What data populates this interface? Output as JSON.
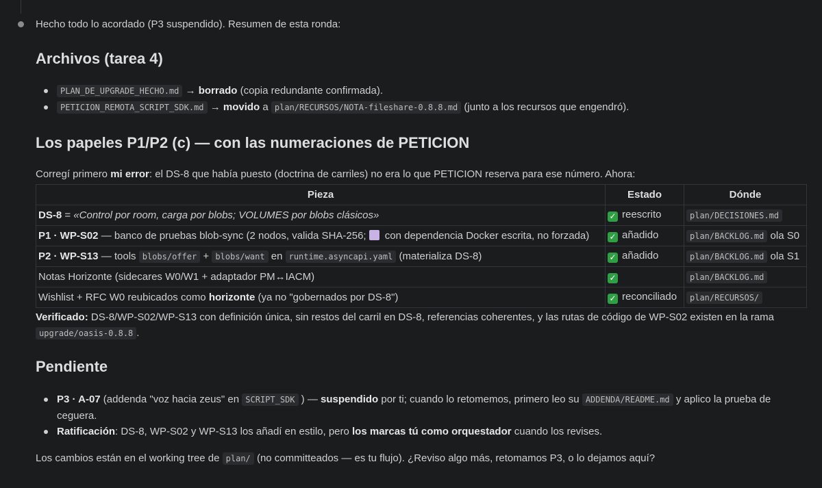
{
  "intro": "Hecho todo lo acordado (P3 suspendido). Resumen de esta ronda:",
  "section1": {
    "heading": "Archivos (tarea 4)",
    "items": [
      {
        "file": "PLAN_DE_UPGRADE_HECHO.md",
        "arrow": "→",
        "action": "borrado",
        "rest": "(copia redundante confirmada)."
      },
      {
        "file": "PETICION_REMOTA_SCRIPT_SDK.md",
        "arrow": "→",
        "action": "movido",
        "mid": "a",
        "path": "plan/RECURSOS/NOTA-fileshare-0.8.8.md",
        "rest": "(junto a los recursos que engendró)."
      }
    ]
  },
  "section2": {
    "heading": "Los papeles P1/P2 (c) — con las numeraciones de PETICION",
    "intro_pre": "Corregí primero",
    "intro_bold": "mi error",
    "intro_post": ": el DS-8 que había puesto (doctrina de carriles) no era lo que PETICION reserva para ese número. Ahora:",
    "table": {
      "headers": [
        "Pieza",
        "Estado",
        "Dónde"
      ],
      "rows": [
        {
          "p_bold": "DS-8",
          "p_mid": " = ",
          "p_italic": "«Control por room, carga por blobs; VOLUMES por blobs clásicos»",
          "estado": "reescrito",
          "donde": "plan/DECISIONES.md",
          "donde_extra": ""
        },
        {
          "p_bold": "P1 · WP-S02",
          "p_text": " — banco de pruebas blob-sync (2 nodos, valida SHA-256;",
          "p_text2": " con dependencia Docker escrita, no forzada)",
          "estado": "añadido",
          "donde": "plan/BACKLOG.md",
          "donde_extra": " ola S0"
        },
        {
          "p_bold": "P2 · WP-S13",
          "p_text": " — tools ",
          "code1": "blobs/offer",
          "plus": " + ",
          "code2": "blobs/want",
          "en": " en ",
          "code3": "runtime.asyncapi.yaml",
          "p_text2": " (materializa DS-8)",
          "estado": "añadido",
          "donde": "plan/BACKLOG.md",
          "donde_extra": " ola S1"
        },
        {
          "p_text": "Notas Horizonte (sidecares W0/W1 + adaptador PM↔IACM)",
          "estado": "",
          "donde": "plan/BACKLOG.md",
          "donde_extra": ""
        },
        {
          "p_text": "Wishlist + RFC W0 reubicados como ",
          "p_bold2": "horizonte",
          "p_text2": " (ya no \"gobernados por DS-8\")",
          "estado": "reconciliado",
          "donde": "plan/RECURSOS/",
          "donde_extra": ""
        }
      ]
    },
    "verified_label": "Verificado:",
    "verified_text": " DS-8/WP-S02/WP-S13 con definición única, sin restos del carril en DS-8, referencias coherentes, y las rutas de código de WP-S02 existen en la rama",
    "verified_code": "upgrade/oasis-0.8.8",
    "verified_end": "."
  },
  "section3": {
    "heading": "Pendiente",
    "items": [
      {
        "bold": "P3 · A-07",
        "t1": " (addenda \"voz hacia zeus\" en ",
        "code1": "SCRIPT_SDK",
        "t2": " ) — ",
        "bold2": "suspendido",
        "t3": " por ti; cuando lo retomemos, primero leo su ",
        "code2": "ADDENDA/README.md",
        "t4": " y aplico la prueba de ceguera."
      },
      {
        "bold": "Ratificación",
        "t1": ": DS-8, WP-S02 y WP-S13 los añadí en estilo, pero ",
        "bold2": "los marcas tú como orquestador",
        "t2": " cuando los revises."
      }
    ]
  },
  "closing": {
    "pre": "Los cambios están en el working tree de ",
    "code": "plan/",
    "post": " (no committeados — es tu flujo). ¿Reviso algo más, retomamos P3, o lo dejamos aquí?"
  },
  "colors": {
    "background": "#1b1c1e",
    "check": "#2ea043",
    "square": "#c9b2e6"
  },
  "icons": {
    "check": "check-icon",
    "square": "purple-square-icon"
  }
}
